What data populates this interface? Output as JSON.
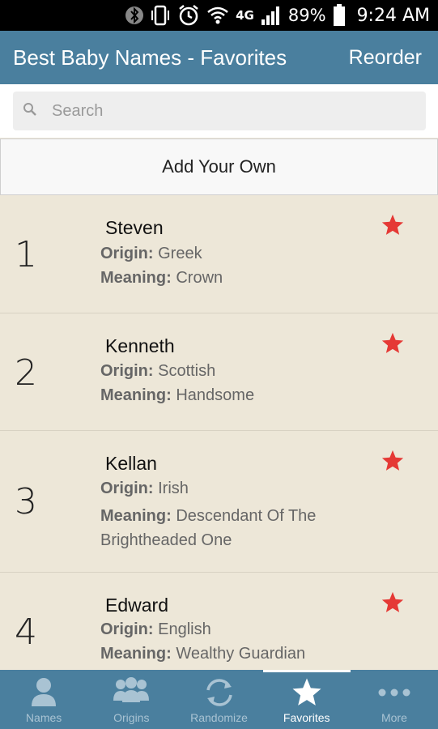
{
  "status_bar": {
    "network": "4G",
    "battery": "89%",
    "time": "9:24 AM"
  },
  "app_bar": {
    "title": "Best Baby Names - Favorites",
    "action": "Reorder"
  },
  "search": {
    "placeholder": "Search",
    "value": ""
  },
  "add_own_label": "Add Your Own",
  "origin_label": "Origin:",
  "meaning_label": "Meaning:",
  "favorites": [
    {
      "rank": "1",
      "name": "Steven",
      "origin": "Greek",
      "meaning": "Crown",
      "favorited": true
    },
    {
      "rank": "2",
      "name": "Kenneth",
      "origin": "Scottish",
      "meaning": "Handsome",
      "favorited": true
    },
    {
      "rank": "3",
      "name": "Kellan",
      "origin": "Irish",
      "meaning": "Descendant Of The Brightheaded One",
      "favorited": true
    },
    {
      "rank": "4",
      "name": "Edward",
      "origin": "English",
      "meaning": "Wealthy Guardian",
      "favorited": true
    }
  ],
  "bottom_nav": {
    "items": [
      {
        "label": "Names",
        "icon": "person-icon",
        "active": false
      },
      {
        "label": "Origins",
        "icon": "group-icon",
        "active": false
      },
      {
        "label": "Randomize",
        "icon": "refresh-icon",
        "active": false
      },
      {
        "label": "Favorites",
        "icon": "star-icon",
        "active": true
      },
      {
        "label": "More",
        "icon": "more-dots-icon",
        "active": false
      }
    ]
  },
  "colors": {
    "app_bar": "#4a7f9e",
    "list_bg": "#ede7d8",
    "star": "#e53935",
    "status_bar": "#000000"
  }
}
